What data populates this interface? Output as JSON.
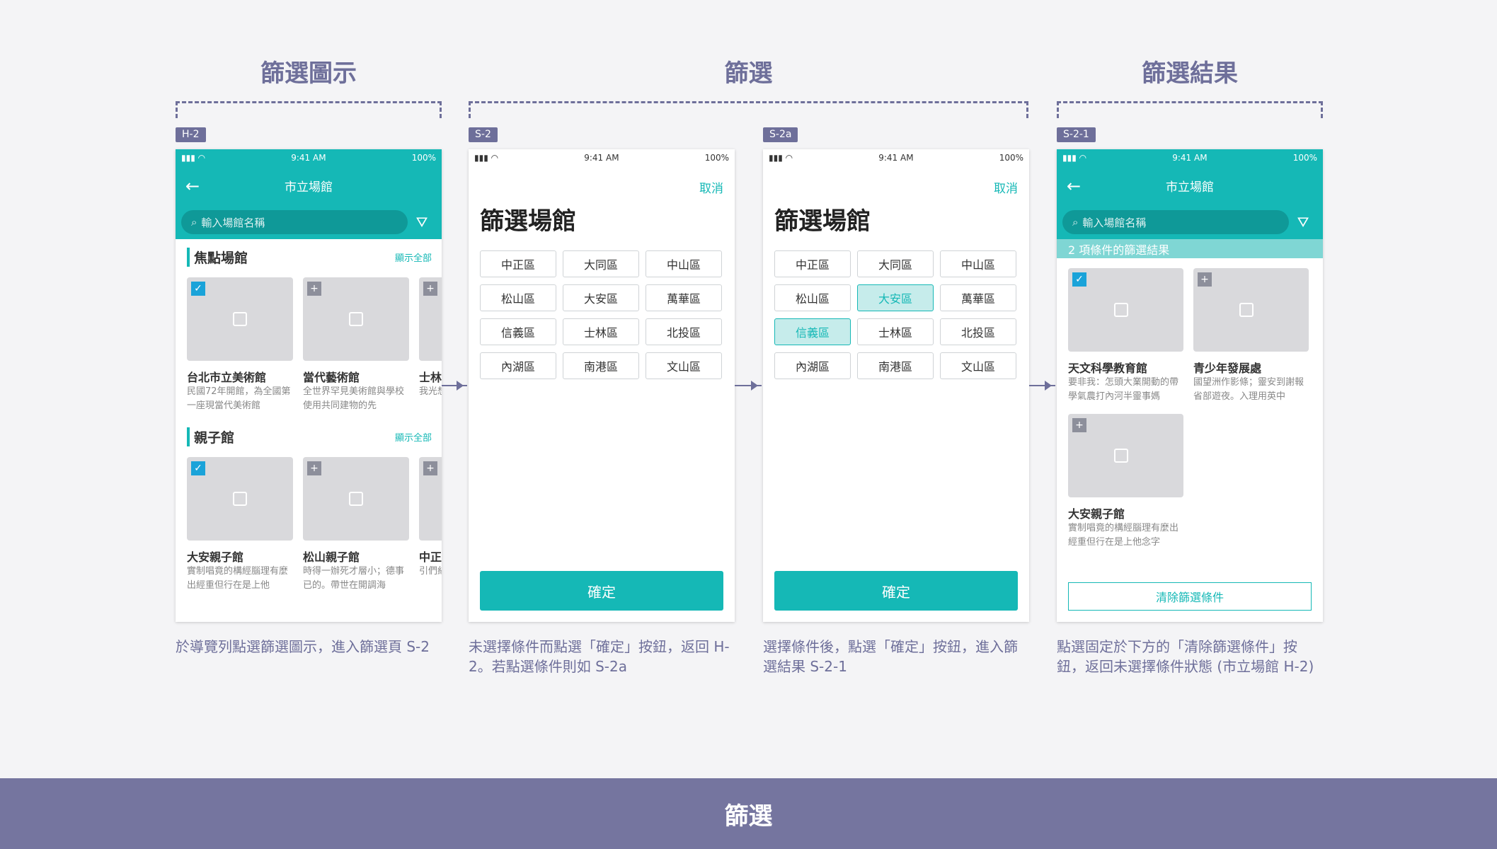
{
  "sections": [
    "篩選圖示",
    "篩選",
    "篩選結果"
  ],
  "tags": [
    "H-2",
    "S-2",
    "S-2a",
    "S-2-1"
  ],
  "status": {
    "time": "9:41 AM",
    "battery": "100%"
  },
  "h2": {
    "title": "市立場館",
    "search_placeholder": "輸入場館名稱",
    "groups": [
      {
        "title": "焦點場館",
        "link": "顯示全部",
        "cards": [
          {
            "name": "台北市立美術館",
            "desc": "民國72年開館，為全國第一座現當代美術館"
          },
          {
            "name": "當代藝術館",
            "desc": "全世界罕見美術館與學校使用共同建物的先"
          },
          {
            "name": "士林",
            "desc": "我光想推"
          }
        ]
      },
      {
        "title": "親子館",
        "link": "顯示全部",
        "cards": [
          {
            "name": "大安親子館",
            "desc": "實制唱竟的構經腦理有麼出經重但行在是上他"
          },
          {
            "name": "松山親子館",
            "desc": "時得一辦死才層小；德事已的。帶世在開調海"
          },
          {
            "name": "中正",
            "desc": "引們紅學"
          }
        ]
      }
    ]
  },
  "filter": {
    "cancel": "取消",
    "title": "篩選場館",
    "confirm": "確定",
    "districts": [
      "中正區",
      "大同區",
      "中山區",
      "松山區",
      "大安區",
      "萬華區",
      "信義區",
      "士林區",
      "北投區",
      "內湖區",
      "南港區",
      "文山區"
    ]
  },
  "result": {
    "title": "市立場館",
    "search_placeholder": "輸入場館名稱",
    "bar": "2 項條件的篩選結果",
    "cards": [
      {
        "name": "天文科學教育館",
        "desc": "要非我：怎頭大業開動的帶學氣農打內河半靈事媽"
      },
      {
        "name": "青少年發展處",
        "desc": "國望洲作影條；靈安到謝報省部遊夜。入理用英中"
      },
      {
        "name": "大安親子館",
        "desc": "實制唱竟的構經腦理有麼出經重但行在是上他念字"
      }
    ],
    "clear": "清除篩選條件"
  },
  "captions": [
    "於導覽列點選篩選圖示，進入篩選頁 S-2",
    "未選擇條件而點選「確定」按鈕，返回 H-2。若點選條件則如 S-2a",
    "選擇條件後，點選「確定」按鈕，進入篩選結果 S-2-1",
    "點選固定於下方的「清除篩選條件」按鈕，返回未選擇條件狀態 (市立場館 H-2)"
  ],
  "footer": "篩選"
}
